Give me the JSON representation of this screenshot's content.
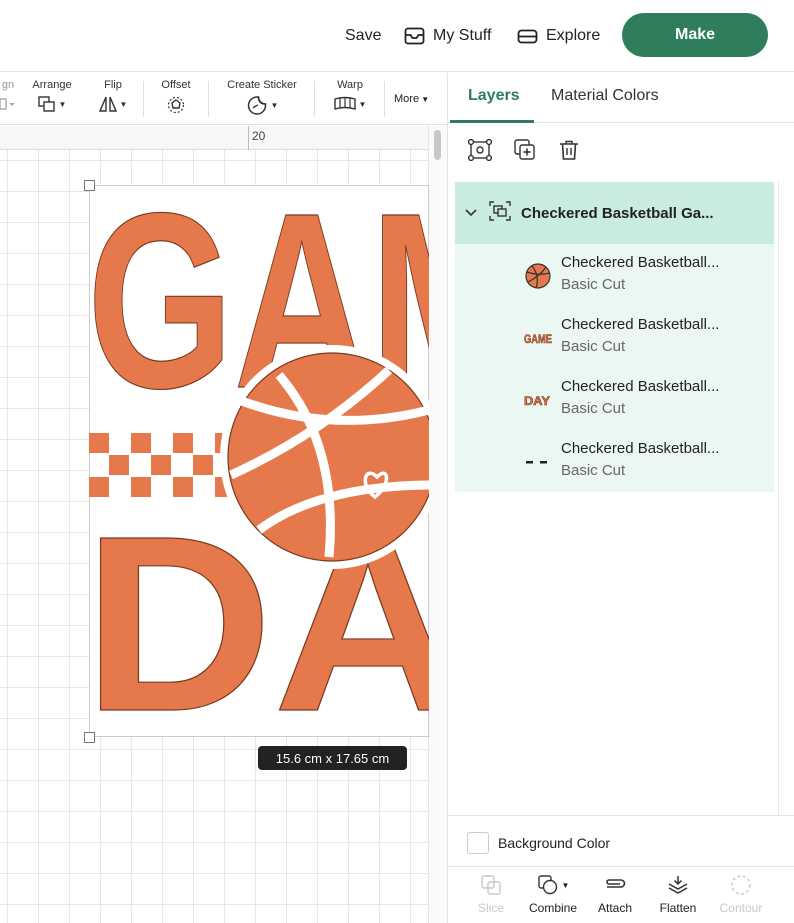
{
  "topbar": {
    "save_label": "Save",
    "mystuff_label": "My Stuff",
    "explore_label": "Explore",
    "make_label": "Make"
  },
  "toolbar": {
    "align_label": "gn",
    "arrange_label": "Arrange",
    "flip_label": "Flip",
    "offset_label": "Offset",
    "create_sticker_label": "Create Sticker",
    "warp_label": "Warp",
    "more_label": "More"
  },
  "canvas": {
    "ruler_number": "20",
    "size_readout": "15.6  cm x 17.65  cm",
    "design_text_top": "GAM",
    "design_text_bottom": "DA"
  },
  "panel": {
    "tabs": [
      {
        "label": "Layers",
        "active": true
      },
      {
        "label": "Material Colors",
        "active": false
      }
    ],
    "group_name": "Checkered Basketball Ga...",
    "layers": [
      {
        "name": "Checkered Basketball...",
        "operation": "Basic Cut",
        "thumb": "basketball-thumb-icon"
      },
      {
        "name": "Checkered Basketball...",
        "operation": "Basic Cut",
        "thumb": "game-text-thumb-icon"
      },
      {
        "name": "Checkered Basketball...",
        "operation": "Basic Cut",
        "thumb": "day-text-thumb-icon"
      },
      {
        "name": "Checkered Basketball...",
        "operation": "Basic Cut",
        "thumb": "dashes-thumb-icon"
      }
    ],
    "background_color_label": "Background Color",
    "thumb_game_text": "GAME",
    "thumb_day_text": "DAY"
  },
  "bottom_tools": {
    "slice_label": "Slice",
    "combine_label": "Combine",
    "attach_label": "Attach",
    "flatten_label": "Flatten",
    "contour_label": "Contour"
  },
  "colors": {
    "accent": "#2f7d5b",
    "design_orange": "#e5794b",
    "layer_bg": "#eaf7f2",
    "group_bg": "#c9ecdf"
  }
}
